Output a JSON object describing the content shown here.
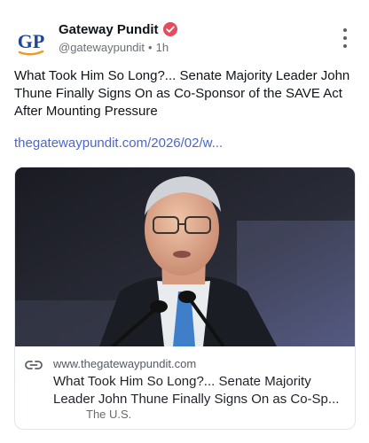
{
  "author": {
    "avatar_text": "GP",
    "name": "Gateway Pundit",
    "handle": "@gatewaypundit",
    "separator": "•",
    "time": "1h",
    "verified_icon": "verified-badge-icon",
    "more_icon": "vertical-ellipsis-icon"
  },
  "post": {
    "text": "What Took Him So Long?... Senate Majority Leader John Thune Finally Signs On as Co-Sponsor of the SAVE Act After Mounting Pressure",
    "link": "thegatewaypundit.com/2026/02/w..."
  },
  "card": {
    "image_icon": "speaker-photo",
    "link_icon": "link-icon",
    "domain": "www.thegatewaypundit.com",
    "title": "What Took Him So Long?... Senate Majority Leader John Thune Finally Signs On as Co-Sp...",
    "category": "The U.S."
  },
  "colors": {
    "link": "#4c67c9",
    "verified": "#e84b5c",
    "brand_blue": "#1f4796",
    "brand_orange": "#f29a1f"
  }
}
